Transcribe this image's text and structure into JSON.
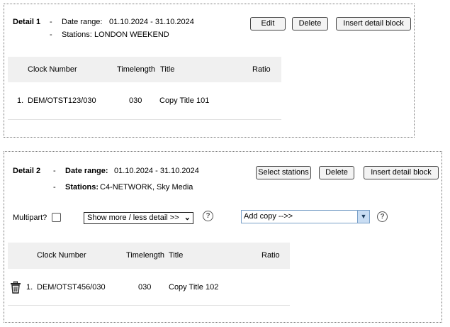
{
  "details": [
    {
      "title": "Detail 1",
      "date_label": "Date range:",
      "date_value": "01.10.2024 - 31.10.2024",
      "stations_label": "Stations:",
      "stations_value": "LONDON WEEKEND",
      "buttons": {
        "edit": "Edit",
        "delete": "Delete",
        "insert": "Insert detail block"
      },
      "headers": {
        "clock": "Clock Number",
        "timelength": "Timelength",
        "title": "Title",
        "ratio": "Ratio"
      },
      "rows": [
        {
          "index": "1.",
          "clock": "DEM/OTST123/030",
          "timelength": "030",
          "title": "Copy Title 101"
        }
      ]
    },
    {
      "title": "Detail 2",
      "date_label": "Date range:",
      "date_value": "01.10.2024 - 31.10.2024",
      "stations_label": "Stations:",
      "stations_value": "C4-NETWORK, Sky Media",
      "buttons": {
        "select_stations": "Select stations",
        "delete": "Delete",
        "insert": "Insert detail block"
      },
      "multipart_label": "Multipart?",
      "detail_select": "Show more / less detail >>",
      "copy_select": "Add copy -->>",
      "help": "?",
      "headers": {
        "clock": "Clock Number",
        "timelength": "Timelength",
        "title": "Title",
        "ratio": "Ratio"
      },
      "rows": [
        {
          "index": "1.",
          "clock": "DEM/OTST456/030",
          "timelength": "030",
          "title": "Copy Title 102"
        }
      ]
    }
  ],
  "icons": {
    "trash": "trash-icon",
    "dropdown": "chevron-down-icon",
    "help": "help-icon"
  },
  "colors": {
    "table_header_bg": "#f0f0f0",
    "dropdown_accent": "#c9ddf3"
  }
}
